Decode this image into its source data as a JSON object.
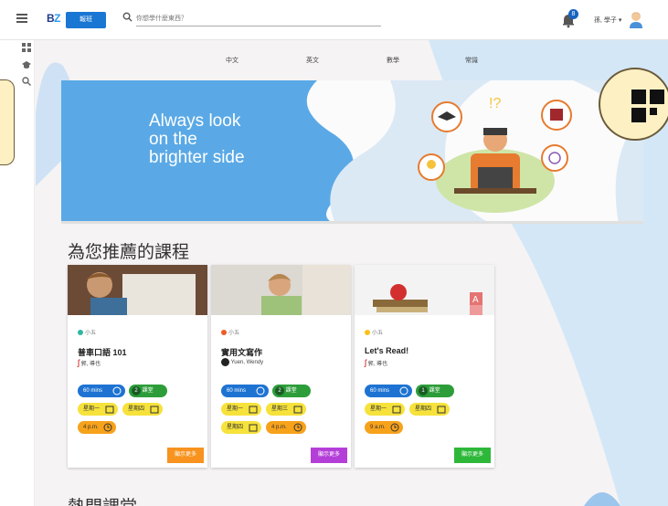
{
  "topbar": {
    "logo_b": "B",
    "logo_z": "Z",
    "button_label": "報班",
    "search_placeholder": "你想學什麼東西？",
    "notification_count": "8",
    "user_name": "孫, 學子 ▾"
  },
  "nav": {
    "languages": [
      "中文",
      "英文",
      "數學",
      "常識"
    ]
  },
  "banner": {
    "line1": "Always look",
    "line2": "on the",
    "line3": "brighter side",
    "color": "#5aa9e6"
  },
  "recommended": {
    "title": "為您推薦的課程",
    "cards": [
      {
        "level": "小五",
        "title": "普車口語 101",
        "teacher": "郭, 導也",
        "duration": "60 mins",
        "sessions": "2",
        "sessions_label": "課堂",
        "day1": "星期一",
        "day2": "星期四",
        "time": "4 p.m.",
        "more_label": "顯示更多",
        "more_color": "#f7931e"
      },
      {
        "level": "小五",
        "title": "實用文寫作",
        "teacher": "Yuen, Wendy",
        "duration": "60 mins",
        "sessions": "2",
        "sessions_label": "課堂",
        "day1": "星期一",
        "day2": "星期三",
        "day3": "星期四",
        "time": "4 p.m.",
        "more_label": "顯示更多",
        "more_color": "#b43fd8"
      },
      {
        "level": "小五",
        "title": "Let's Read!",
        "teacher": "郭, 導也",
        "duration": "60 mins",
        "sessions": "1",
        "sessions_label": "課堂",
        "day1": "星期一",
        "day2": "星期四",
        "time": "9 a.m.",
        "more_label": "顯示更多",
        "more_color": "#2eb83a"
      }
    ]
  },
  "hot": {
    "title": "熱門課堂"
  },
  "colors": {
    "blue_pill": "#1e73d2",
    "green_pill": "#2d9d3a",
    "yellow_pill": "#f6e23b",
    "orange_pill": "#f7a21b"
  }
}
